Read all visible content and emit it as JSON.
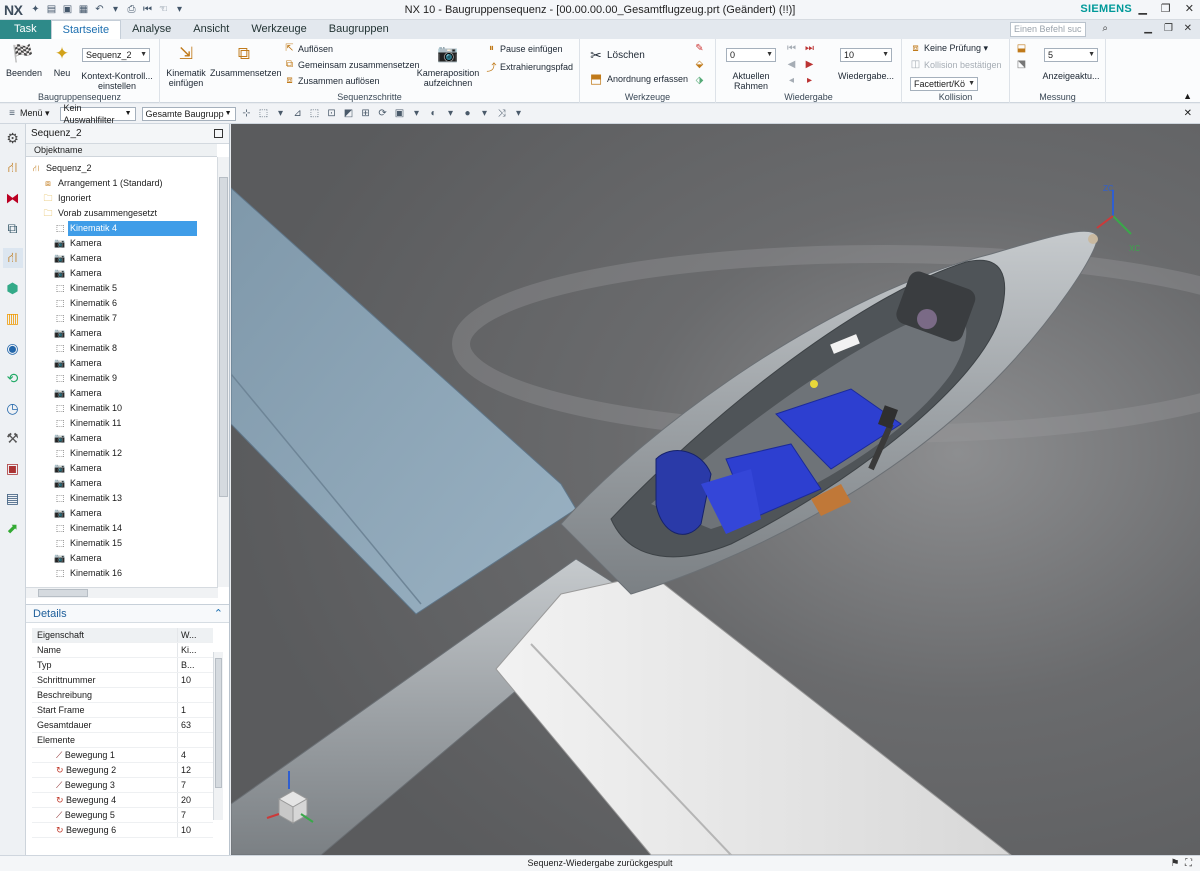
{
  "app": {
    "logo": "NX",
    "title": "NX 10 - Baugruppensequenz - [00.00.00.00_Gesamtflugzeug.prt (Geändert)    (!!)]",
    "brand": "SIEMENS",
    "search_placeholder": "Einen Befehl suc"
  },
  "tabs": [
    {
      "label": "Task"
    },
    {
      "label": "Startseite"
    },
    {
      "label": "Analyse"
    },
    {
      "label": "Ansicht"
    },
    {
      "label": "Werkzeuge"
    },
    {
      "label": "Baugruppen"
    }
  ],
  "ribbon": {
    "g1": {
      "label": "Baugruppensequenz",
      "beenden": "Beenden",
      "neu": "Neu",
      "seq_value": "Sequenz_2",
      "kontext": "Kontext-Kontroll...",
      "einstellen": "einstellen"
    },
    "g2": {
      "label": "Sequenzschritte",
      "kinematik": "Kinematik",
      "einfuegen": "einfügen",
      "zusammensetzen": "Zusammensetzen",
      "aufloesen": "Auflösen",
      "gemeinsam": "Gemeinsam zusammensetzen",
      "zus_aufloesen": "Zusammen auflösen",
      "kamera": "Kameraposition",
      "aufzeichnen": "aufzeichnen",
      "pause": "Pause einfügen",
      "extrahierung": "Extrahierungspfad"
    },
    "g3": {
      "label": "Werkzeuge",
      "loeschen": "Löschen",
      "anordnung": "Anordnung erfassen"
    },
    "g4": {
      "label": "Wiedergabe",
      "frame_value": "0",
      "aktuellen": "Aktuellen",
      "rahmen": "Rahmen",
      "speed_value": "10",
      "wiedergabe": "Wiedergabe..."
    },
    "g5": {
      "label": "Kollision",
      "pruefung": "Keine Prüfung ▾",
      "bestaetigen": "Kollision bestätigen",
      "facettiert": "Facettiert/Kö"
    },
    "g6": {
      "label": "Messung",
      "value": "5",
      "anzeige": "Anzeigeaktu..."
    }
  },
  "toolbar": {
    "menu": "Menü ▾",
    "filter": "Kein Auswahlfilter",
    "scope": "Gesamte Baugrupp"
  },
  "nav": {
    "title": "Sequenz_2",
    "column": "Objektname",
    "rows": [
      {
        "label": "Sequenz_2",
        "icon": "sequence-icon",
        "indent": 0
      },
      {
        "label": "Arrangement 1 (Standard)",
        "icon": "arrangement-icon",
        "indent": 1
      },
      {
        "label": "Ignoriert",
        "icon": "folder-icon",
        "indent": 1
      },
      {
        "label": "Vorab zusammengesetzt",
        "icon": "folder-icon",
        "indent": 1
      },
      {
        "label": "Kinematik 4",
        "icon": "kinematik-icon",
        "indent": 2,
        "selected": true
      },
      {
        "label": "Kamera",
        "icon": "camera-icon",
        "indent": 2
      },
      {
        "label": "Kamera",
        "icon": "camera-icon",
        "indent": 2
      },
      {
        "label": "Kamera",
        "icon": "camera-icon",
        "indent": 2
      },
      {
        "label": "Kinematik 5",
        "icon": "kinematik-icon",
        "indent": 2
      },
      {
        "label": "Kinematik 6",
        "icon": "kinematik-icon",
        "indent": 2
      },
      {
        "label": "Kinematik 7",
        "icon": "kinematik-icon",
        "indent": 2
      },
      {
        "label": "Kamera",
        "icon": "camera-icon",
        "indent": 2
      },
      {
        "label": "Kinematik 8",
        "icon": "kinematik-icon",
        "indent": 2
      },
      {
        "label": "Kamera",
        "icon": "camera-icon",
        "indent": 2
      },
      {
        "label": "Kinematik 9",
        "icon": "kinematik-icon",
        "indent": 2
      },
      {
        "label": "Kamera",
        "icon": "camera-icon",
        "indent": 2
      },
      {
        "label": "Kinematik 10",
        "icon": "kinematik-icon",
        "indent": 2
      },
      {
        "label": "Kinematik 11",
        "icon": "kinematik-icon",
        "indent": 2
      },
      {
        "label": "Kamera",
        "icon": "camera-icon",
        "indent": 2
      },
      {
        "label": "Kinematik 12",
        "icon": "kinematik-icon",
        "indent": 2
      },
      {
        "label": "Kamera",
        "icon": "camera-icon",
        "indent": 2
      },
      {
        "label": "Kamera",
        "icon": "camera-icon",
        "indent": 2
      },
      {
        "label": "Kinematik 13",
        "icon": "kinematik-icon",
        "indent": 2
      },
      {
        "label": "Kamera",
        "icon": "camera-icon",
        "indent": 2
      },
      {
        "label": "Kinematik 14",
        "icon": "kinematik-icon",
        "indent": 2
      },
      {
        "label": "Kinematik 15",
        "icon": "kinematik-icon",
        "indent": 2
      },
      {
        "label": "Kamera",
        "icon": "camera-icon",
        "indent": 2
      },
      {
        "label": "Kinematik 16",
        "icon": "kinematik-icon",
        "indent": 2
      }
    ]
  },
  "details": {
    "title": "Details",
    "col_prop": "Eigenschaft",
    "col_val": "W...",
    "rows": [
      {
        "k": "Name",
        "v": "Ki..."
      },
      {
        "k": "Typ",
        "v": "B..."
      },
      {
        "k": "Schrittnummer",
        "v": "10"
      },
      {
        "k": "Beschreibung",
        "v": ""
      },
      {
        "k": "Start Frame",
        "v": "1"
      },
      {
        "k": "Gesamtdauer",
        "v": "63"
      },
      {
        "k": "Elemente",
        "v": ""
      },
      {
        "k": "Bewegung 1",
        "v": "4",
        "sub": true,
        "icon": "linear-move-icon"
      },
      {
        "k": "Bewegung 2",
        "v": "12",
        "sub": true,
        "icon": "rotate-move-icon"
      },
      {
        "k": "Bewegung 3",
        "v": "7",
        "sub": true,
        "icon": "linear-move-icon"
      },
      {
        "k": "Bewegung 4",
        "v": "20",
        "sub": true,
        "icon": "rotate-move-icon"
      },
      {
        "k": "Bewegung 5",
        "v": "7",
        "sub": true,
        "icon": "linear-move-icon"
      },
      {
        "k": "Bewegung 6",
        "v": "10",
        "sub": true,
        "icon": "rotate-move-icon"
      }
    ]
  },
  "viewport": {
    "axis_zc": "ZC",
    "axis_xc": "XC"
  },
  "status": {
    "text": "Sequenz-Wiedergabe zurückgespult"
  },
  "colors": {
    "accent": "#2e8a89",
    "selection": "#3f9de8",
    "wing": "#8ea7b8",
    "fuselage": "#a9adb1",
    "seat": "#2d3fd0"
  }
}
